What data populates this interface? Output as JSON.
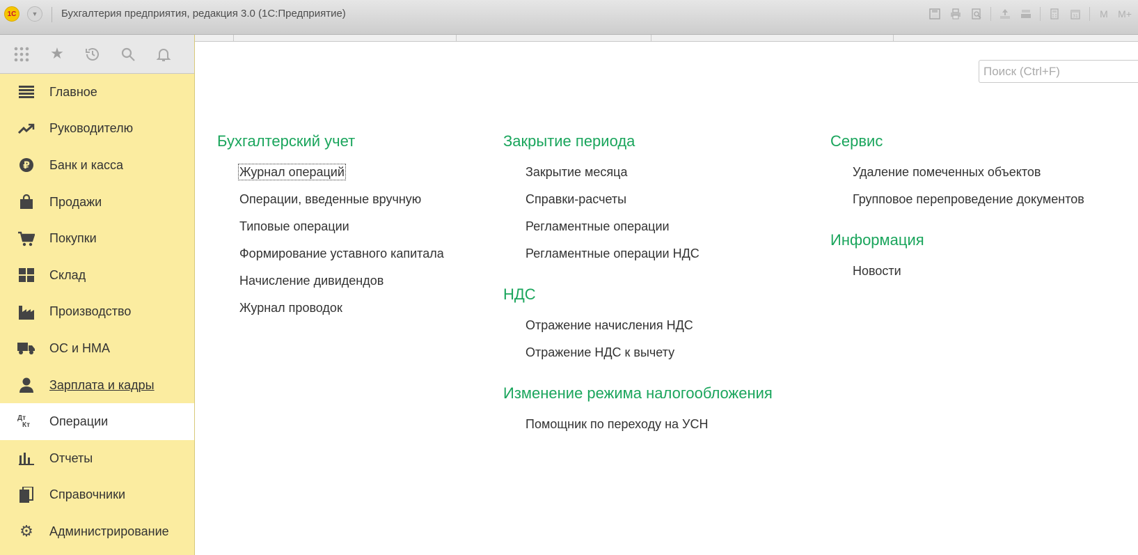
{
  "titlebar": {
    "logo": "1С",
    "title": "Бухгалтерия предприятия, редакция 3.0  (1С:Предприятие)",
    "icons": [
      "save-icon",
      "print-icon",
      "preview-icon",
      "upload-icon",
      "download-icon",
      "calculator-icon",
      "calendar-icon"
    ],
    "memory_labels": [
      "M",
      "M+"
    ]
  },
  "sidebar": {
    "tools": [
      "apps-grid-icon",
      "star-icon",
      "history-icon",
      "search-icon",
      "bell-icon"
    ],
    "items": [
      {
        "label": "Главное",
        "icon": "menu-icon"
      },
      {
        "label": "Руководителю",
        "icon": "trend-icon"
      },
      {
        "label": "Банк и касса",
        "icon": "ruble-icon"
      },
      {
        "label": "Продажи",
        "icon": "shopping-bag-icon"
      },
      {
        "label": "Покупки",
        "icon": "cart-icon"
      },
      {
        "label": "Склад",
        "icon": "warehouse-icon"
      },
      {
        "label": "Производство",
        "icon": "factory-icon"
      },
      {
        "label": "ОС и НМА",
        "icon": "truck-icon"
      },
      {
        "label": "Зарплата и кадры",
        "icon": "person-icon"
      },
      {
        "label": "Операции",
        "icon": "dt-kt-icon"
      },
      {
        "label": "Отчеты",
        "icon": "bar-chart-icon"
      },
      {
        "label": "Справочники",
        "icon": "books-icon"
      },
      {
        "label": "Администрирование",
        "icon": "gear-icon"
      }
    ],
    "dtkt": {
      "top": "Дт",
      "bottom": "Кт"
    }
  },
  "search": {
    "placeholder": "Поиск (Ctrl+F)"
  },
  "columns": [
    {
      "groups": [
        {
          "title": "Бухгалтерский учет",
          "links": [
            "Журнал операций",
            "Операции, введенные вручную",
            "Типовые операции",
            "Формирование уставного капитала",
            "Начисление дивидендов",
            "Журнал проводок"
          ]
        }
      ]
    },
    {
      "groups": [
        {
          "title": "Закрытие периода",
          "links": [
            "Закрытие месяца",
            "Справки-расчеты",
            "Регламентные операции",
            "Регламентные операции НДС"
          ]
        },
        {
          "title": "НДС",
          "links": [
            "Отражение начисления НДС",
            "Отражение НДС к вычету"
          ]
        },
        {
          "title": "Изменение режима налогообложения",
          "links": [
            "Помощник по переходу на УСН"
          ]
        }
      ]
    },
    {
      "groups": [
        {
          "title": "Сервис",
          "links": [
            "Удаление помеченных объектов",
            "Групповое перепроведение документов"
          ]
        },
        {
          "title": "Информация",
          "links": [
            "Новости"
          ]
        }
      ]
    }
  ]
}
